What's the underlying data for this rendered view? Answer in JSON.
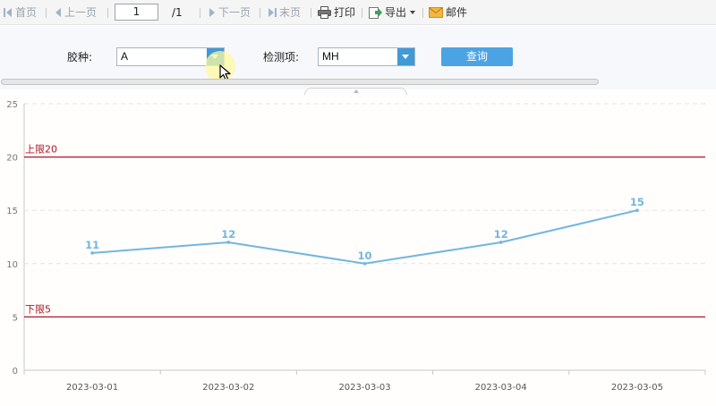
{
  "toolbar": {
    "first": "首页",
    "prev": "上一页",
    "current_page": "1",
    "total_pages": "/1",
    "next": "下一页",
    "last": "末页",
    "print": "打印",
    "export": "导出",
    "mail": "邮件"
  },
  "params": {
    "glue_label": "胶种:",
    "glue_value": "A",
    "item_label": "检测项:",
    "item_value": "MH",
    "query_label": "查询"
  },
  "chart_data": {
    "type": "line",
    "categories": [
      "2023-03-01",
      "2023-03-02",
      "2023-03-03",
      "2023-03-04",
      "2023-03-05"
    ],
    "series": [
      {
        "values": [
          11,
          12,
          10,
          12,
          15
        ],
        "color": "#72b5e0"
      }
    ],
    "ylim": [
      0,
      25
    ],
    "yticks": [
      0,
      5,
      10,
      15,
      20,
      25
    ],
    "grid": true,
    "data_labels": true,
    "reference_lines": [
      {
        "label": "上限20",
        "value": 20,
        "color": "#b0152a"
      },
      {
        "label": "下限5",
        "value": 5,
        "color": "#b0152a"
      }
    ],
    "title": "",
    "xlabel": "",
    "ylabel": ""
  }
}
